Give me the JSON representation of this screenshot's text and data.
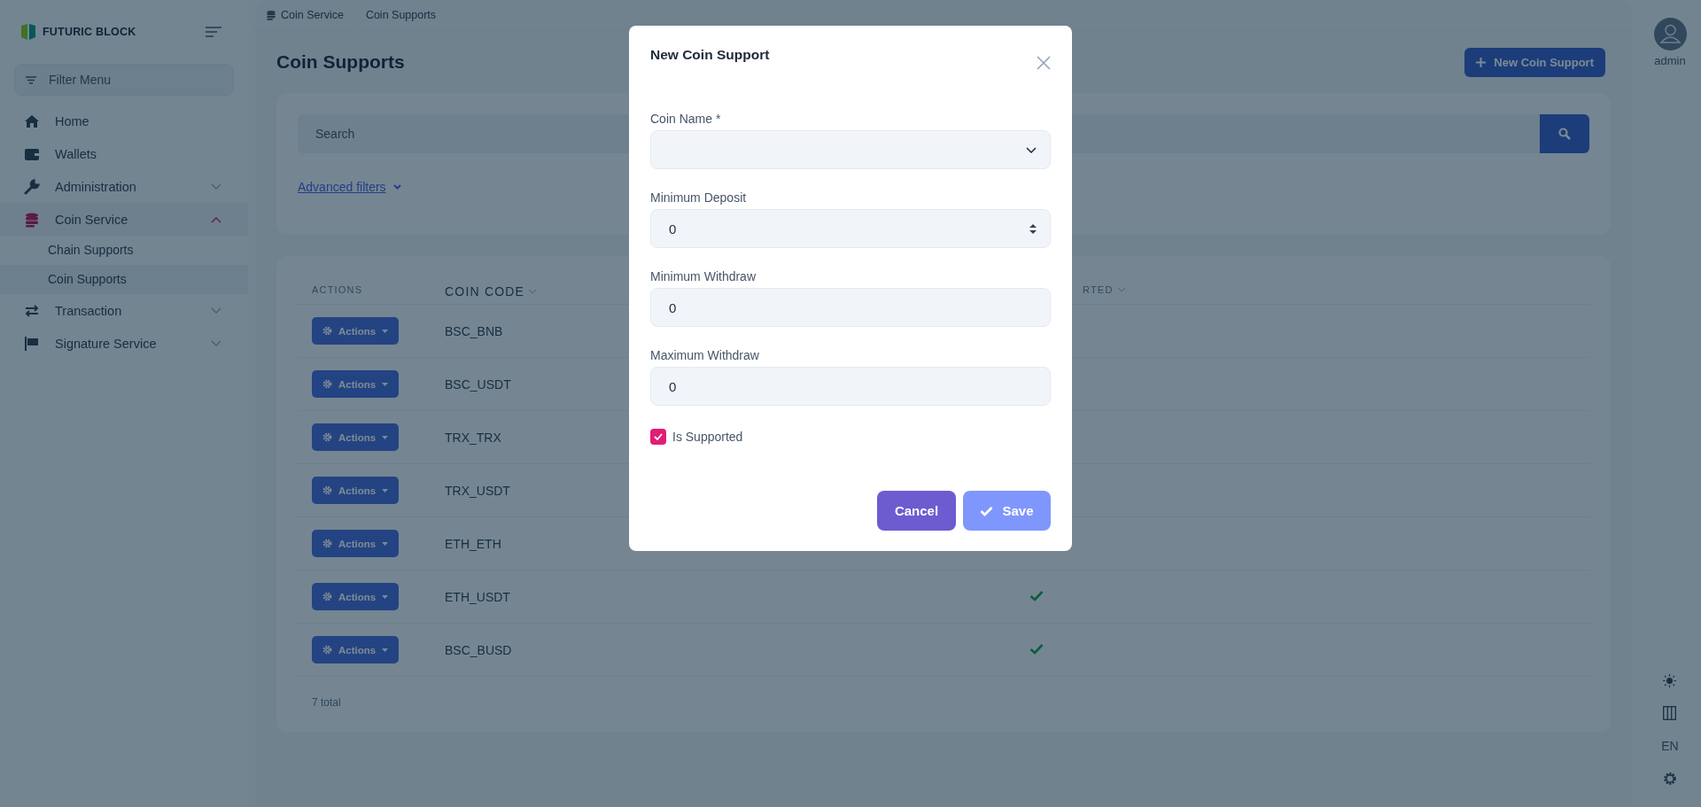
{
  "sidebar": {
    "brand": "FUTURIC BLOCK",
    "filter_placeholder": "Filter Menu",
    "items": [
      {
        "label": "Home",
        "kind": "link"
      },
      {
        "label": "Wallets",
        "kind": "link"
      },
      {
        "label": "Administration",
        "kind": "group",
        "expanded": false
      },
      {
        "label": "Coin Service",
        "kind": "group",
        "expanded": true,
        "children": [
          {
            "label": "Chain Supports",
            "selected": false
          },
          {
            "label": "Coin Supports",
            "selected": true
          }
        ]
      },
      {
        "label": "Transaction",
        "kind": "group",
        "expanded": false
      },
      {
        "label": "Signature Service",
        "kind": "group",
        "expanded": false
      }
    ]
  },
  "breadcrumb": [
    "Coin Service",
    "Coin Supports"
  ],
  "page_title": "Coin Supports",
  "new_button": "New Coin Support",
  "search": {
    "placeholder": "Search"
  },
  "advanced_filters": "Advanced filters",
  "table": {
    "columns": [
      "ACTIONS",
      "COIN CODE",
      "RTED"
    ],
    "rows": [
      {
        "action": "Actions",
        "code": "BSC_BNB"
      },
      {
        "action": "Actions",
        "code": "BSC_USDT"
      },
      {
        "action": "Actions",
        "code": "TRX_TRX"
      },
      {
        "action": "Actions",
        "code": "TRX_USDT"
      },
      {
        "action": "Actions",
        "code": "ETH_ETH"
      },
      {
        "action": "Actions",
        "code": "ETH_USDT",
        "supported": true
      },
      {
        "action": "Actions",
        "code": "BSC_BUSD",
        "supported": true
      }
    ],
    "total": "7 total"
  },
  "user": {
    "name": "admin"
  },
  "rail": {
    "language": "EN"
  },
  "modal": {
    "title": "New Coin Support",
    "fields": [
      {
        "label": "Coin Name *",
        "kind": "select"
      },
      {
        "label": "Minimum Deposit",
        "kind": "number",
        "value": "0"
      },
      {
        "label": "Minimum Withdraw",
        "kind": "text",
        "value": "0"
      },
      {
        "label": "Maximum Withdraw",
        "kind": "text",
        "value": "0"
      }
    ],
    "checkbox": {
      "label": "Is Supported",
      "checked": true
    },
    "buttons": [
      {
        "label": "Cancel",
        "kind": "cancel"
      },
      {
        "label": "Save",
        "kind": "save"
      }
    ]
  }
}
